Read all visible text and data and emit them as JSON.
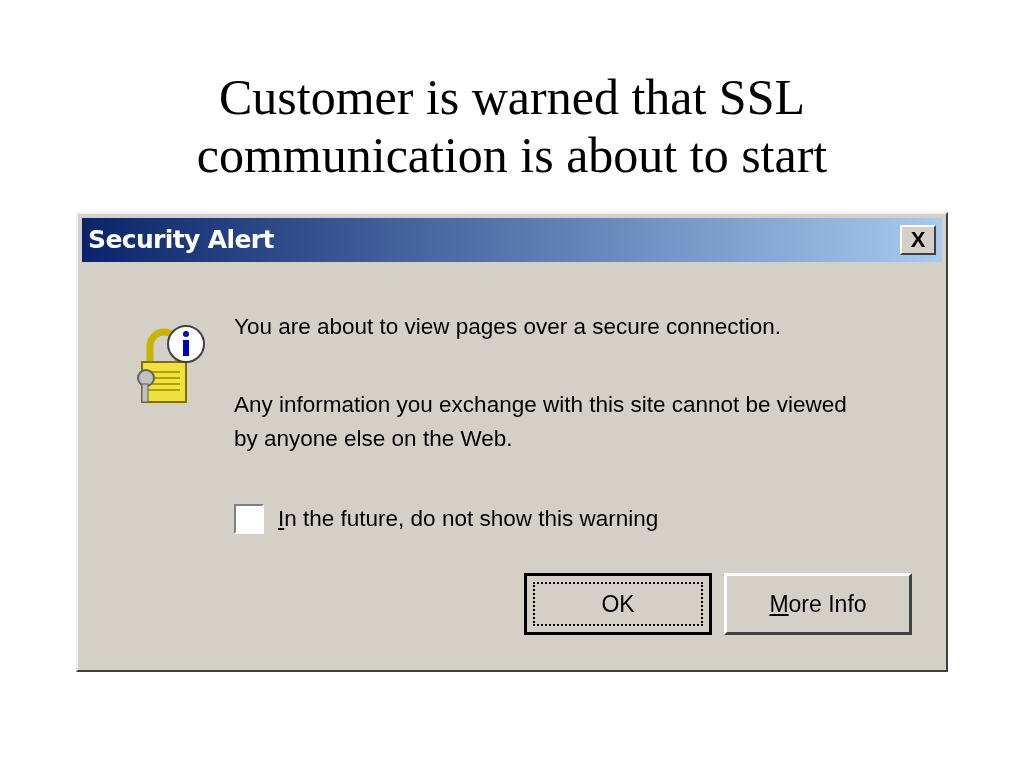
{
  "slide": {
    "title": "Customer is warned that SSL communication is about to start"
  },
  "dialog": {
    "title": "Security Alert",
    "close_label": "X",
    "messages": [
      "You are about to view pages over a secure connection.",
      "Any information you exchange with this site cannot be viewed by anyone else on the Web."
    ],
    "checkbox": {
      "mnemonic": "I",
      "rest": "n the future, do not show this warning",
      "checked": false
    },
    "buttons": [
      {
        "rest": "OK",
        "default": true
      },
      {
        "mnemonic": "M",
        "rest": "ore Info",
        "default": false
      }
    ]
  }
}
